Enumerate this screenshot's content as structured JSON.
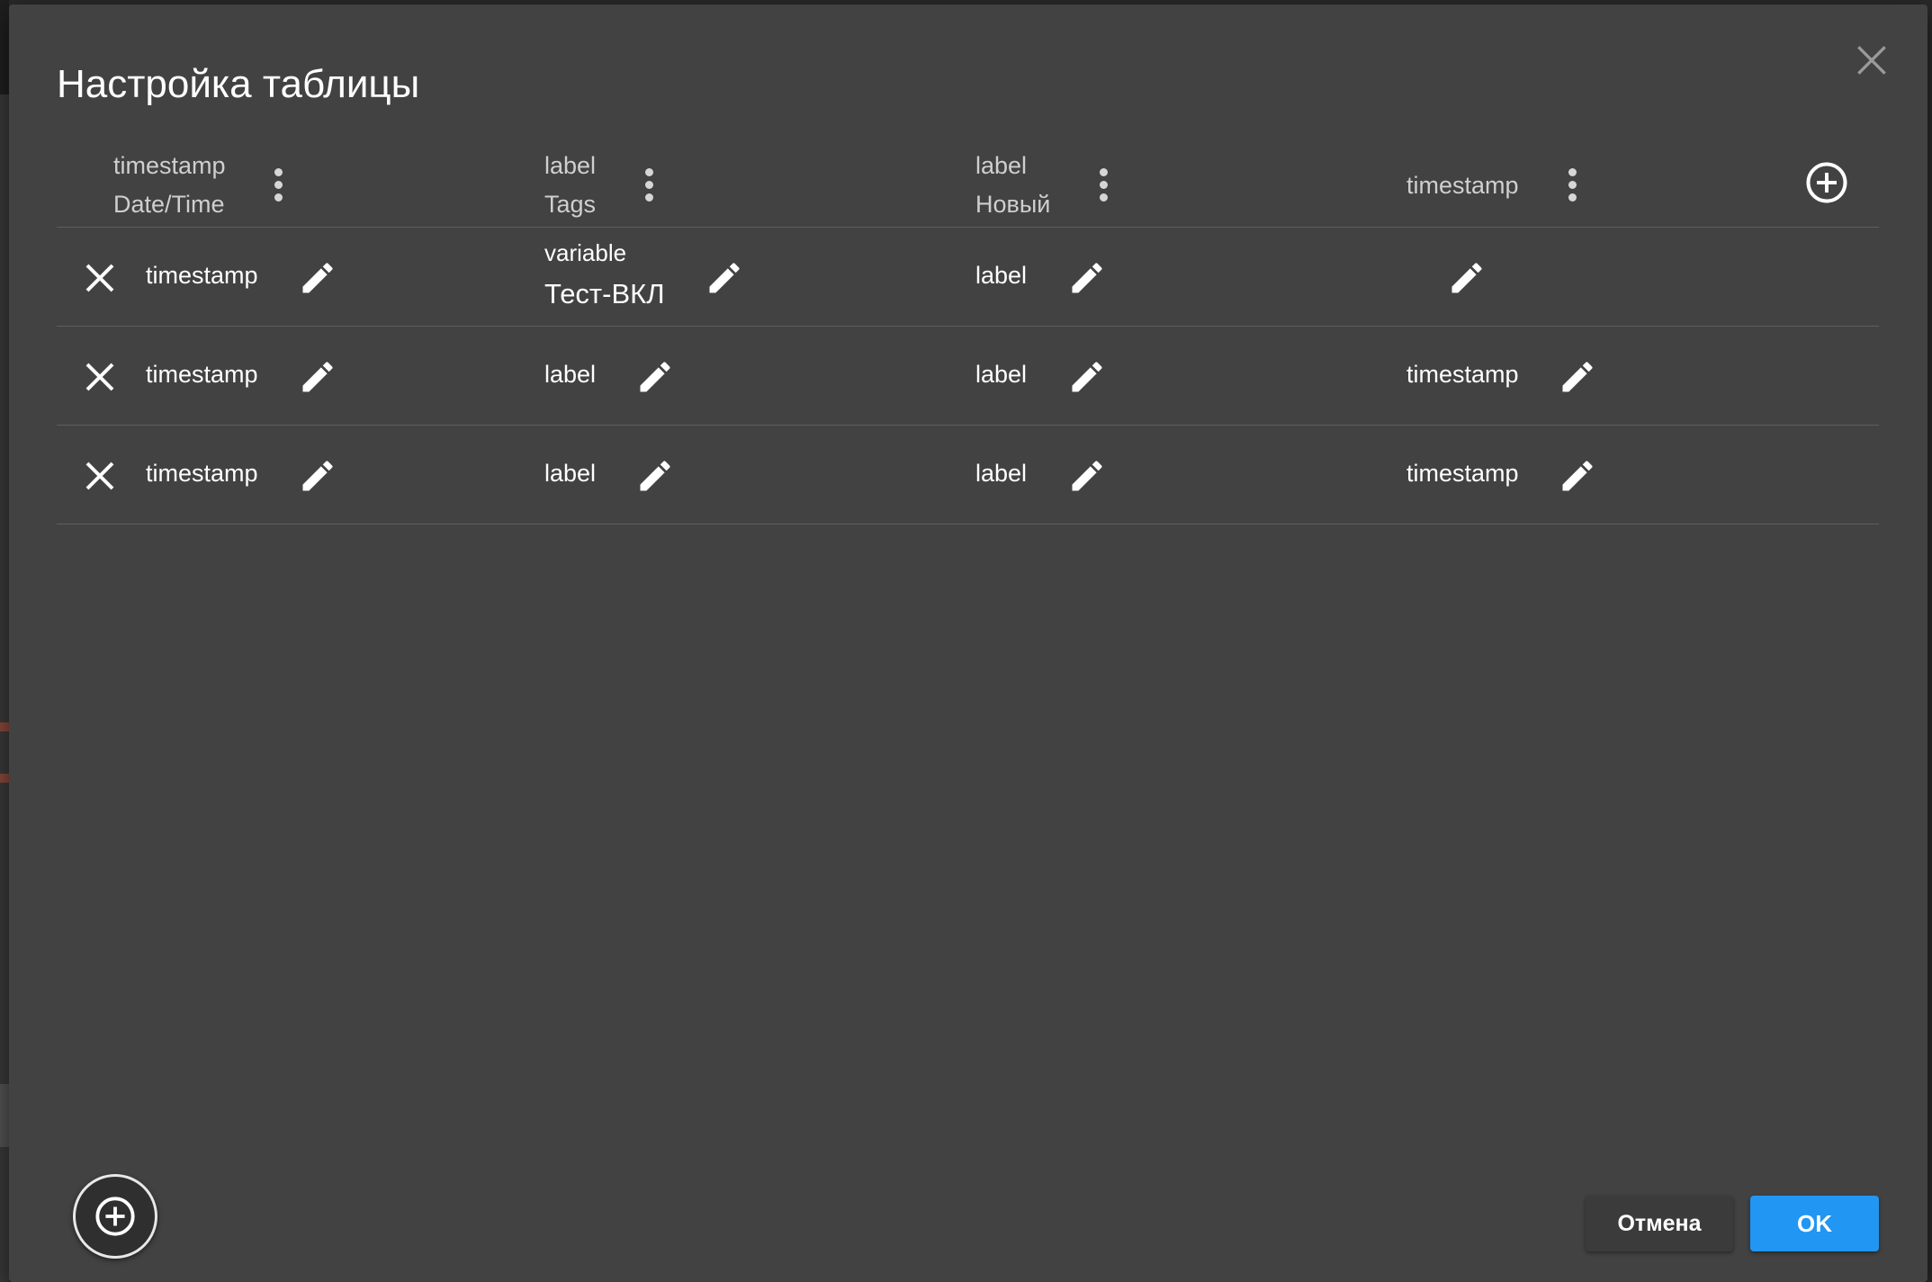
{
  "dialog": {
    "title": "Настройка таблицы",
    "close_icon": "close-icon"
  },
  "columns": [
    {
      "line1": "timestamp",
      "line2": "Date/Time"
    },
    {
      "line1": "label",
      "line2": "Tags"
    },
    {
      "line1": "label",
      "line2": "Новый"
    },
    {
      "line1": "timestamp",
      "line2": ""
    }
  ],
  "rows": [
    {
      "cells": [
        {
          "text": "timestamp"
        },
        {
          "sub": "variable",
          "text": "Тест-ВКЛ"
        },
        {
          "text": "label"
        },
        {
          "text": ""
        }
      ]
    },
    {
      "cells": [
        {
          "text": "timestamp"
        },
        {
          "text": "label"
        },
        {
          "text": "label"
        },
        {
          "text": "timestamp"
        }
      ]
    },
    {
      "cells": [
        {
          "text": "timestamp"
        },
        {
          "text": "label"
        },
        {
          "text": "label"
        },
        {
          "text": "timestamp"
        }
      ]
    }
  ],
  "footer": {
    "cancel_label": "Отмена",
    "ok_label": "OK"
  },
  "colors": {
    "dialog_bg": "#424242",
    "primary": "#2196f3",
    "divider": "#5e5e5e"
  }
}
